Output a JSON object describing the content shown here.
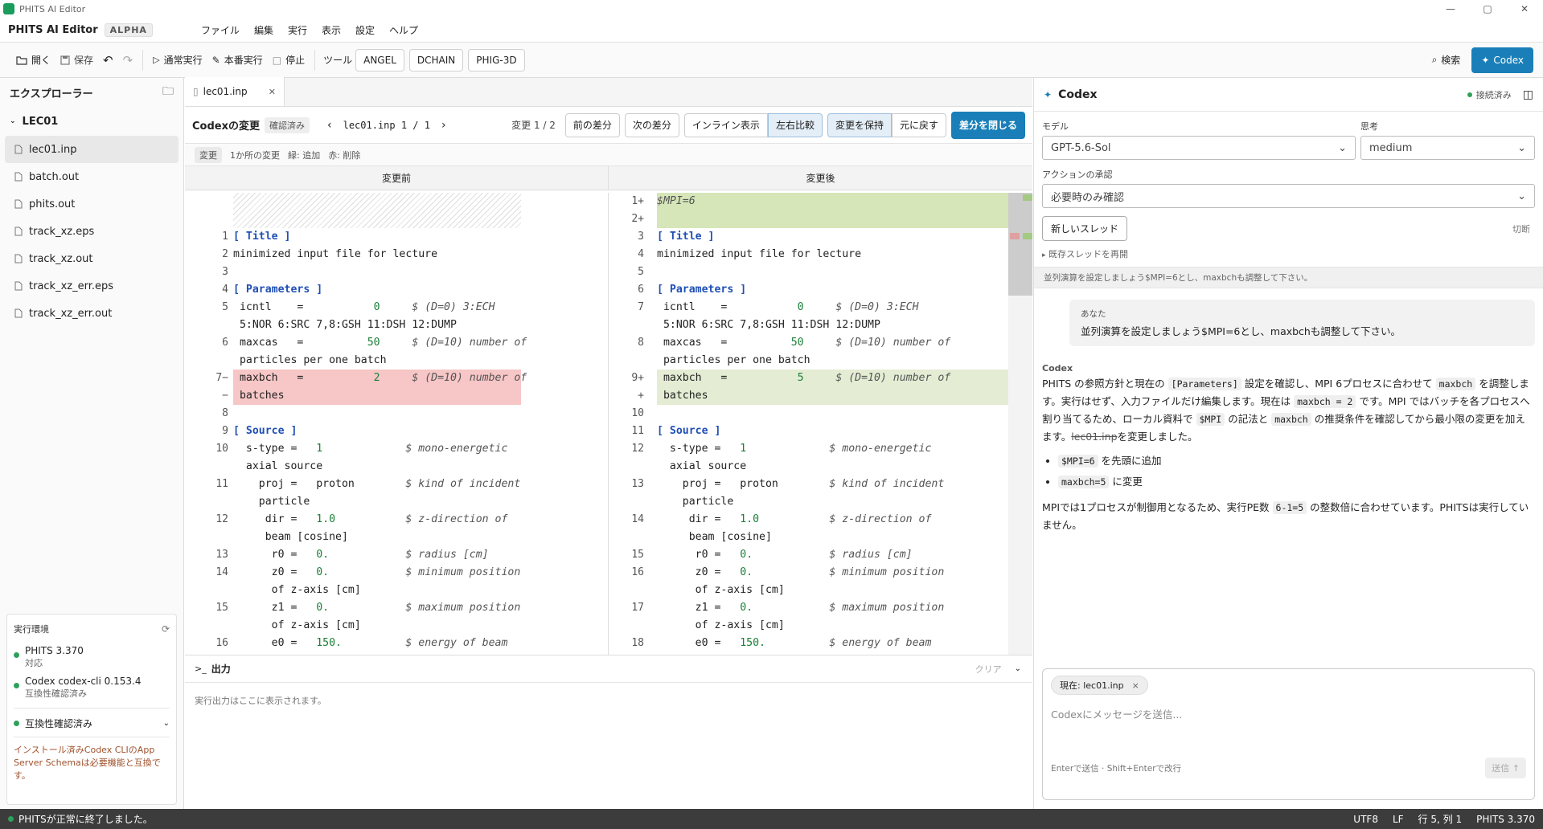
{
  "window": {
    "title": "PHITS AI Editor"
  },
  "menubar": {
    "app_name": "PHITS AI Editor",
    "badge": "ALPHA",
    "menus": [
      "ファイル",
      "編集",
      "実行",
      "表示",
      "設定",
      "ヘルプ"
    ]
  },
  "toolbar": {
    "open": "開く",
    "save": "保存",
    "run_normal": "通常実行",
    "run_prod": "本番実行",
    "stop": "停止",
    "tools": "ツール",
    "angel": "ANGEL",
    "dchain": "DCHAIN",
    "phig3d": "PHIG-3D",
    "search": "検索",
    "codex": "Codex"
  },
  "explorer": {
    "title": "エクスプローラー",
    "folder": "LEC01",
    "files": [
      "lec01.inp",
      "batch.out",
      "phits.out",
      "track_xz.eps",
      "track_xz.out",
      "track_xz_err.eps",
      "track_xz_err.out"
    ]
  },
  "env": {
    "title": "実行環境",
    "phits_name": "PHITS 3.370",
    "phits_status": "対応",
    "codex_name": "Codex codex-cli 0.153.4",
    "codex_status": "互換性確認済み",
    "compat_label": "互換性確認済み",
    "compat_note": "インストール済みCodex CLIのApp Server Schemaは必要機能と互換です。"
  },
  "tab": {
    "name": "lec01.inp"
  },
  "diffbar": {
    "title": "Codexの変更",
    "state": "確認済み",
    "file": "lec01.inp 1 / 1",
    "change_count": "変更 1 / 2",
    "prev": "前の差分",
    "next": "次の差分",
    "inline": "インライン表示",
    "side": "左右比較",
    "keep": "変更を保持",
    "revert": "元に戻す",
    "close": "差分を閉じる"
  },
  "legend": {
    "tag": "変更",
    "count": "1か所の変更",
    "added": "緑: 追加",
    "removed": "赤: 削除"
  },
  "panes": {
    "before": "変更前",
    "after": "変更後"
  },
  "output": {
    "title": "出力",
    "clear": "クリア",
    "placeholder": "実行出力はここに表示されます。"
  },
  "codex": {
    "title": "Codex",
    "connected": "接続済み",
    "model_label": "モデル",
    "model_value": "GPT-5.6-Sol",
    "think_label": "思考",
    "think_value": "medium",
    "approval_label": "アクションの承認",
    "approval_value": "必要時のみ確認",
    "new_thread": "新しいスレッド",
    "cut": "切断",
    "resume": "既存スレッドを再開",
    "prompt_preview": "並列演算を設定しましょう$MPI=6とし、maxbchも調整して下さい。",
    "you": "あなた",
    "user_msg": "並列演算を設定しましょう$MPI=6とし、maxbchも調整して下さい。",
    "codex_label": "Codex",
    "resp_1": "PHITS の参照方針と現在の",
    "resp_code1": "[Parameters]",
    "resp_2": "設定を確認し、MPI 6プロセスに合わせて",
    "resp_code2": "maxbch",
    "resp_3": "を調整します。実行はせず、入力ファイルだけ編集します。現在は",
    "resp_code3": "maxbch = 2",
    "resp_4": "です。MPI ではバッチを各プロセスへ割り当てるため、ローカル資料で",
    "resp_code4": "$MPI",
    "resp_5": "の記法と",
    "resp_code5": "maxbch",
    "resp_6": "の推奨条件を確認してから最小限の変更を加えます。",
    "resp_file": "lec01.inp",
    "resp_7": "を変更しました。",
    "bullet1_code": "$MPI=6",
    "bullet1_text": "を先頭に追加",
    "bullet2_code": "maxbch=5",
    "bullet2_text": "に変更",
    "final_1": "MPIでは1プロセスが制御用となるため、実行PE数",
    "final_code": "6-1=5",
    "final_2": "の整数倍に合わせています。PHITSは実行していません。",
    "context_chip": "現在: lec01.inp",
    "input_placeholder": "Codexにメッセージを送信...",
    "hint": "Enterで送信 · Shift+Enterで改行",
    "send": "送信"
  },
  "status": {
    "message": "PHITSが正常に終了しました。",
    "encoding": "UTF8",
    "eol": "LF",
    "position": "行 5, 列 1",
    "version": "PHITS 3.370"
  },
  "before_lines": [
    {
      "n": "1",
      "t": "[ Title ]"
    },
    {
      "n": "2",
      "t": "minimized input file for lecture"
    },
    {
      "n": "3",
      "t": ""
    },
    {
      "n": "4",
      "t": "[ Parameters ]"
    },
    {
      "n": "5",
      "t": " icntl    =           0     $ (D=0) 3:ECH"
    },
    {
      "n": "",
      "t": " 5:NOR 6:SRC 7,8:GSH 11:DSH 12:DUMP"
    },
    {
      "n": "6",
      "t": " maxcas   =          50     $ (D=10) number of"
    },
    {
      "n": "",
      "t": " particles per one batch"
    },
    {
      "n": "7",
      "t": " maxbch   =           2     $ (D=10) number of"
    },
    {
      "n": "",
      "t": " batches"
    },
    {
      "n": "8",
      "t": ""
    },
    {
      "n": "9",
      "t": "[ Source ]"
    },
    {
      "n": "10",
      "t": "  s-type =   1             $ mono-energetic"
    },
    {
      "n": "",
      "t": "  axial source"
    },
    {
      "n": "11",
      "t": "    proj =   proton        $ kind of incident"
    },
    {
      "n": "",
      "t": "    particle"
    },
    {
      "n": "12",
      "t": "     dir =   1.0           $ z-direction of"
    },
    {
      "n": "",
      "t": "     beam [cosine]"
    },
    {
      "n": "13",
      "t": "      r0 =   0.            $ radius [cm]"
    },
    {
      "n": "14",
      "t": "      z0 =   0.            $ minimum position"
    },
    {
      "n": "",
      "t": "      of z-axis [cm]"
    },
    {
      "n": "15",
      "t": "      z1 =   0.            $ maximum position"
    },
    {
      "n": "",
      "t": "      of z-axis [cm]"
    },
    {
      "n": "16",
      "t": "      e0 =   150.          $ energy of beam"
    }
  ],
  "after_lines": [
    {
      "n": "1+",
      "t": "$MPI=6"
    },
    {
      "n": "2+",
      "t": ""
    },
    {
      "n": "3",
      "t": "[ Title ]"
    },
    {
      "n": "4",
      "t": "minimized input file for lecture"
    },
    {
      "n": "5",
      "t": ""
    },
    {
      "n": "6",
      "t": "[ Parameters ]"
    },
    {
      "n": "7",
      "t": " icntl    =           0     $ (D=0) 3:ECH"
    },
    {
      "n": "",
      "t": " 5:NOR 6:SRC 7,8:GSH 11:DSH 12:DUMP"
    },
    {
      "n": "8",
      "t": " maxcas   =          50     $ (D=10) number of"
    },
    {
      "n": "",
      "t": " particles per one batch"
    },
    {
      "n": "9+",
      "t": " maxbch   =           5     $ (D=10) number of"
    },
    {
      "n": "+",
      "t": " batches"
    },
    {
      "n": "10",
      "t": ""
    },
    {
      "n": "11",
      "t": "[ Source ]"
    },
    {
      "n": "12",
      "t": "  s-type =   1             $ mono-energetic"
    },
    {
      "n": "",
      "t": "  axial source"
    },
    {
      "n": "13",
      "t": "    proj =   proton        $ kind of incident"
    },
    {
      "n": "",
      "t": "    particle"
    },
    {
      "n": "14",
      "t": "     dir =   1.0           $ z-direction of"
    },
    {
      "n": "",
      "t": "     beam [cosine]"
    },
    {
      "n": "15",
      "t": "      r0 =   0.            $ radius [cm]"
    },
    {
      "n": "16",
      "t": "      z0 =   0.            $ minimum position"
    },
    {
      "n": "",
      "t": "      of z-axis [cm]"
    },
    {
      "n": "17",
      "t": "      z1 =   0.            $ maximum position"
    },
    {
      "n": "",
      "t": "      of z-axis [cm]"
    },
    {
      "n": "18",
      "t": "      e0 =   150.          $ energy of beam"
    }
  ],
  "before_minus": "7−",
  "before_minus2": "−"
}
